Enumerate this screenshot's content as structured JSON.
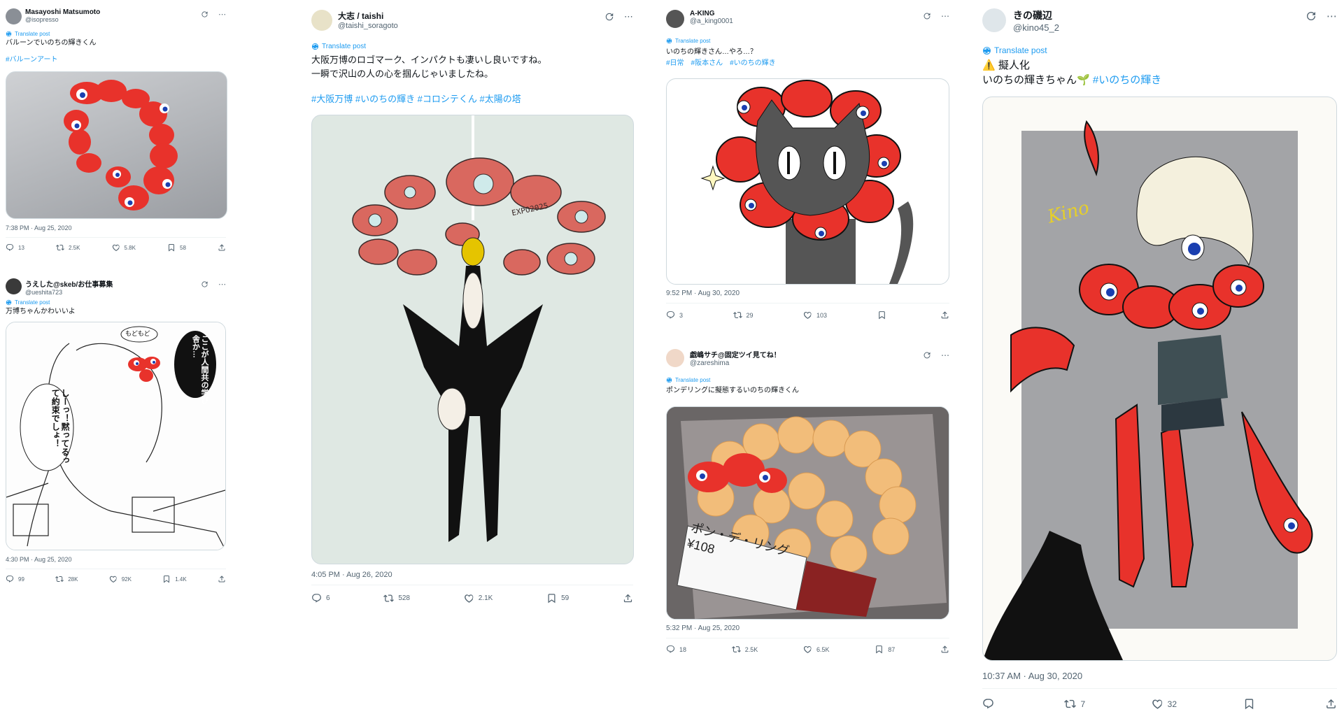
{
  "ui": {
    "translate_label": "Translate post",
    "accent": "#1d9bf0",
    "muted": "#536471",
    "red": "#e8322b"
  },
  "tweets": [
    {
      "name": "Masayoshi Matsumoto",
      "handle": "@isopresso",
      "line1": "バルーンでいのちの輝きくん",
      "hashtags": "#バルーンアート",
      "time": "7:38 PM · Aug 25, 2020",
      "replies": "13",
      "retweets": "2.5K",
      "likes": "5.8K",
      "bookmarks": "58"
    },
    {
      "name": "うえした@skeb/お仕事募集",
      "handle": "@ueshita723",
      "line1": "万博ちゃんかわいいよ",
      "bubble_bottom": "もどもど",
      "bubble1": "ここが人間共の学び舎か…",
      "bubble2": "しーっ！黙ってるって約束でしょ！",
      "time": "4:30 PM · Aug 25, 2020",
      "replies": "99",
      "retweets": "28K",
      "likes": "92K",
      "bookmarks": "1.4K"
    },
    {
      "name": "大志 / taishi",
      "handle": "@taishi_soragoto",
      "line1": "大阪万博のロゴマーク、インパクトも凄いし良いですね。",
      "line2": "一瞬で沢山の人の心を掴んじゃいましたね。",
      "hashtags": "#大阪万博 #いのちの輝き #コロシテくん #太陽の塔",
      "img_label": "EXPO2025",
      "time": "4:05 PM · Aug 26, 2020",
      "replies": "6",
      "retweets": "528",
      "likes": "2.1K",
      "bookmarks": "59"
    },
    {
      "name": "A-KING",
      "handle": "@a_king0001",
      "line1": "いのちの輝きさん…やろ…？",
      "hashtags": "#日常　#阪本さん　#いのちの輝き",
      "time": "9:52 PM · Aug 30, 2020",
      "replies": "3",
      "retweets": "29",
      "likes": "103",
      "bookmarks": ""
    },
    {
      "name": "戯嶋サチ@固定ツイ見てね！",
      "handle": "@zareshima",
      "line1": "ポンデリングに擬態するいのちの輝きくん",
      "img_label1": "ポン・デ・リング",
      "img_label2": "¥108",
      "time": "5:32 PM · Aug 25, 2020",
      "replies": "18",
      "retweets": "2.5K",
      "likes": "6.5K",
      "bookmarks": "87"
    },
    {
      "name": "きの磯辺",
      "handle": "@kino45_2",
      "warning": "⚠️",
      "line1": "擬人化",
      "line2": "いのちの輝きちゃん",
      "seedling": "🌱",
      "hashtags": "#いのちの輝き",
      "img_label": "Kino",
      "time": "10:37 AM · Aug 30, 2020",
      "replies": "",
      "retweets": "7",
      "likes": "32",
      "bookmarks": ""
    }
  ]
}
